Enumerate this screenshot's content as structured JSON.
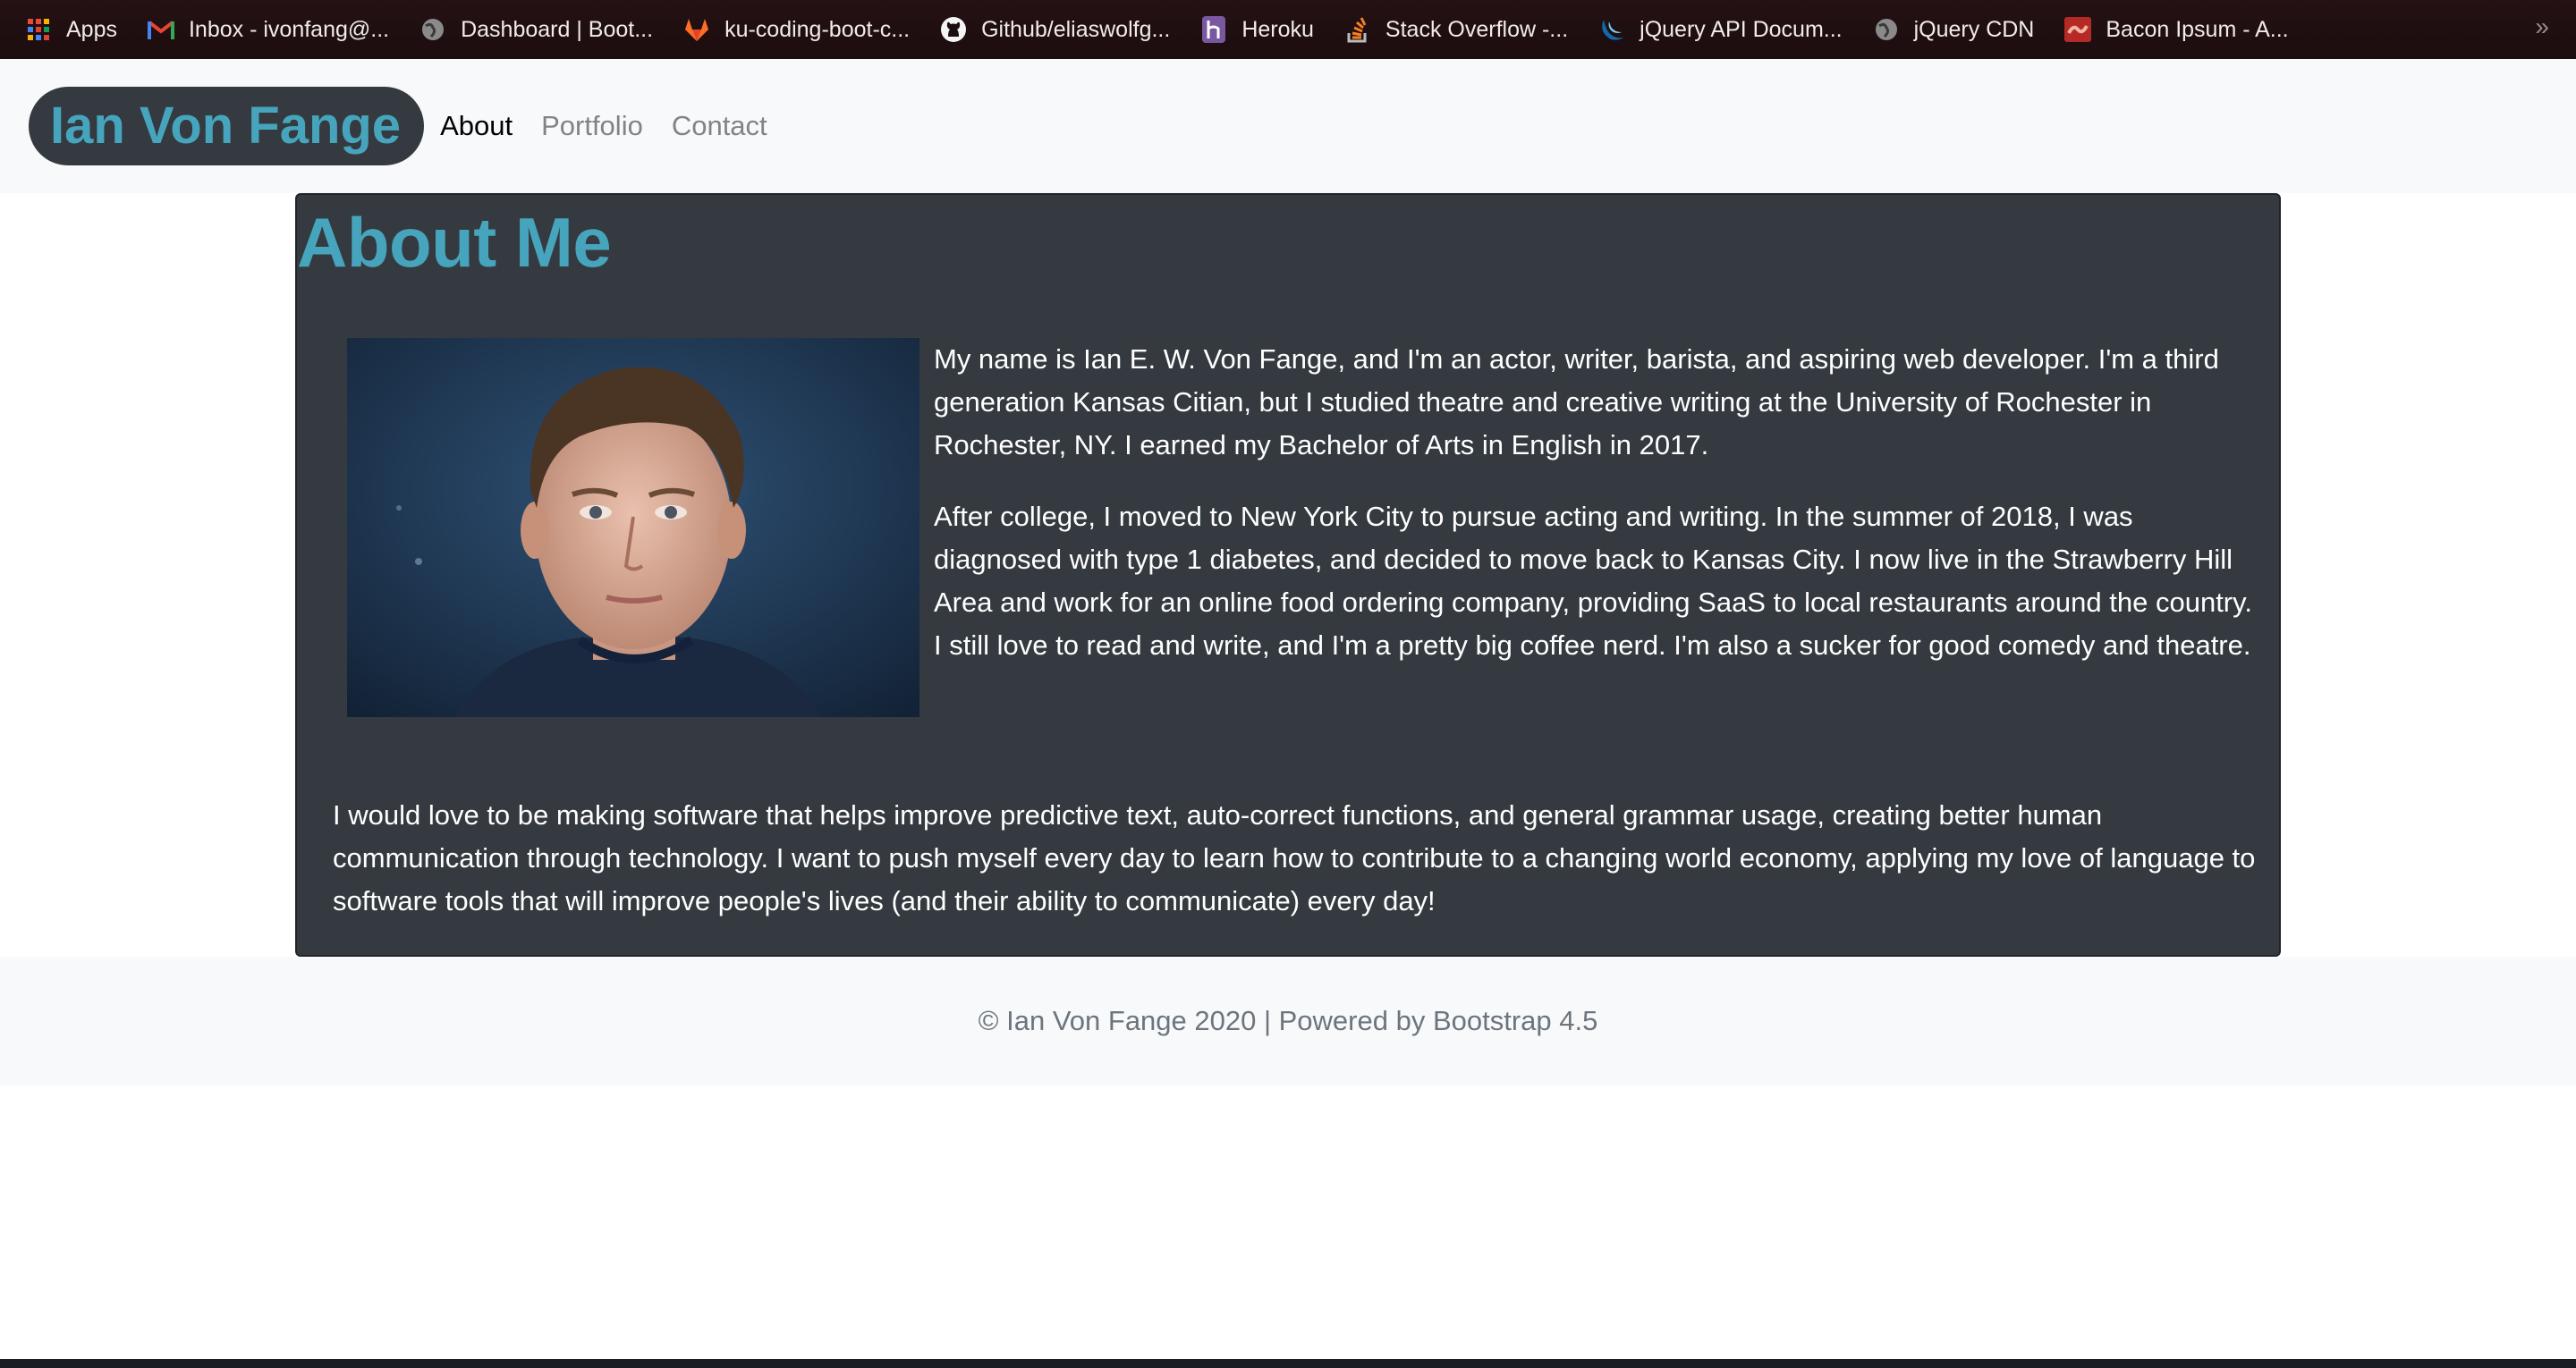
{
  "bookmarks": [
    {
      "label": "Apps",
      "icon": "apps-grid-icon"
    },
    {
      "label": "Inbox - ivonfang@...",
      "icon": "gmail-icon"
    },
    {
      "label": "Dashboard | Boot...",
      "icon": "globe-icon"
    },
    {
      "label": "ku-coding-boot-c...",
      "icon": "gitlab-icon"
    },
    {
      "label": "Github/eliaswolfg...",
      "icon": "github-icon"
    },
    {
      "label": "Heroku",
      "icon": "heroku-icon"
    },
    {
      "label": "Stack Overflow -...",
      "icon": "stackoverflow-icon"
    },
    {
      "label": "jQuery API Docum...",
      "icon": "jquery-icon"
    },
    {
      "label": "jQuery CDN",
      "icon": "globe-icon"
    },
    {
      "label": "Bacon Ipsum - A...",
      "icon": "bacon-icon"
    }
  ],
  "bookmarks_more": "»",
  "navbar": {
    "brand": "Ian Von Fange",
    "links": [
      {
        "label": "About",
        "active": true
      },
      {
        "label": "Portfolio",
        "active": false
      },
      {
        "label": "Contact",
        "active": false
      }
    ]
  },
  "about": {
    "heading": "About Me",
    "paragraph1": "My name is Ian E. W. Von Fange, and I'm an actor, writer, barista, and aspiring web developer. I'm a third generation Kansas Citian, but I studied theatre and creative writing at the University of Rochester in Rochester, NY. I earned my Bachelor of Arts in English in 2017.",
    "paragraph2": "After college, I moved to New York City to pursue acting and writing. In the summer of 2018, I was diagnosed with type 1 diabetes, and decided to move back to Kansas City. I now live in the Strawberry Hill Area and work for an online food ordering company, providing SaaS to local restaurants around the country. I still love to read and write, and I'm a pretty big coffee nerd. I'm also a sucker for good comedy and theatre.",
    "paragraph3": "I would love to be making software that helps improve predictive text, auto-correct functions, and general grammar usage, creating better human communication through technology. I want to push myself every day to learn how to contribute to a changing world economy, applying my love of language to software tools that will improve people's lives (and their ability to communicate) every day!"
  },
  "footer": {
    "text": "© Ian Von Fange 2020 | Powered by Bootstrap 4.5"
  },
  "colors": {
    "brand_text": "#46a5bd",
    "card_bg": "#343a40",
    "navbar_bg": "#f8f9fa"
  }
}
